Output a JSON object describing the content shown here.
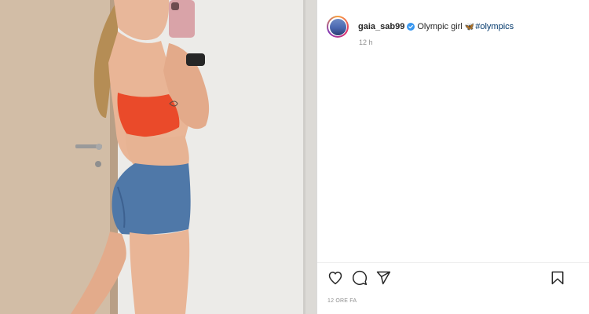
{
  "post": {
    "username": "gaia_sab99",
    "caption_text": "Olympic girl",
    "caption_emoji": "🦋",
    "hashtag": "#olympics",
    "time_ago": "12 h",
    "date_label": "12 ORE FA"
  },
  "icons": {
    "verified": "verified-badge-icon",
    "like": "heart-icon",
    "comment": "comment-icon",
    "share": "paper-plane-icon",
    "save": "bookmark-icon"
  },
  "colors": {
    "text": "#262626",
    "secondary": "#8e8e8e",
    "link": "#00376b",
    "verified": "#3897f0",
    "divider": "#dbdbdb"
  }
}
